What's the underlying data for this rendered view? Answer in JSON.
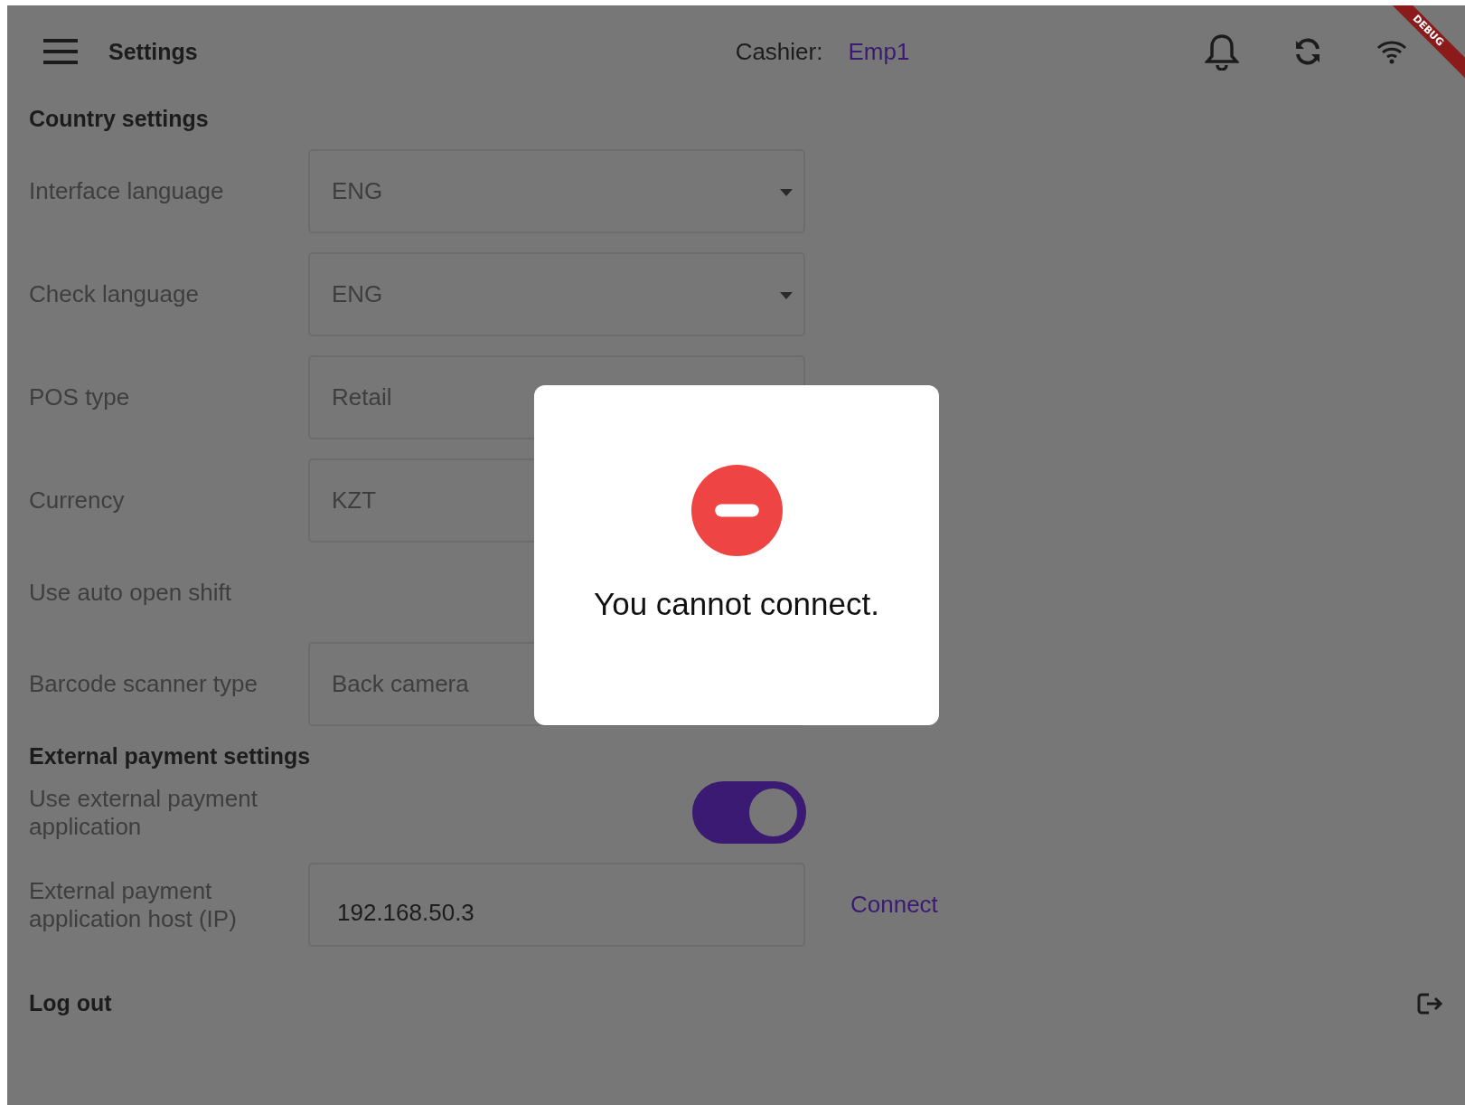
{
  "app_bar": {
    "title": "Settings",
    "cashier_label": "Cashier:",
    "cashier_name": "Emp1"
  },
  "debug_banner": "DEBUG",
  "sections": [
    {
      "title": "Country settings",
      "rows": [
        {
          "kind": "dropdown",
          "label": "Interface language",
          "value": "ENG"
        },
        {
          "kind": "dropdown",
          "label": "Check language",
          "value": "ENG"
        },
        {
          "kind": "field",
          "label": "POS type",
          "value": "Retail"
        },
        {
          "kind": "field",
          "label": "Currency",
          "value": "KZT"
        },
        {
          "kind": "plain",
          "label": "Use auto open shift"
        },
        {
          "kind": "field",
          "label": "Barcode scanner type",
          "value": "Back camera"
        }
      ]
    },
    {
      "title": "External payment settings",
      "rows": [
        {
          "kind": "switch",
          "label": "Use external payment application",
          "on": true
        },
        {
          "kind": "input",
          "label": "External payment application host (IP)",
          "value": "192.168.50.3",
          "action": "Connect"
        }
      ]
    }
  ],
  "logout": "Log out",
  "dialog": {
    "message": "You cannot connect."
  }
}
